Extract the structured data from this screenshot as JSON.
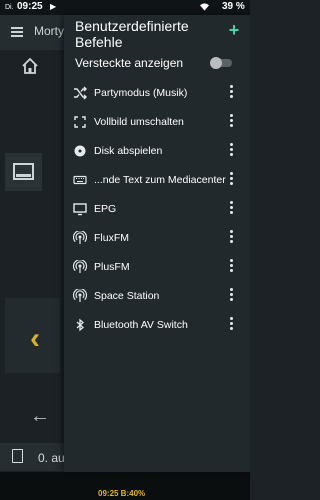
{
  "status_bar": {
    "day": "Di.",
    "time": "09:25",
    "battery": "39 %"
  },
  "background": {
    "app_title": "Morty",
    "bottom_bar_text": "0. au",
    "nav_clock": "09:25  B:40%"
  },
  "drawer": {
    "title": "Benutzerdefinierte Befehle",
    "add_label": "+",
    "show_hidden_label": "Versteckte anzeigen",
    "show_hidden_on": false,
    "items": [
      {
        "icon": "shuffle-icon",
        "label": "Partymodus (Musik)"
      },
      {
        "icon": "fullscreen-icon",
        "label": "Vollbild umschalten"
      },
      {
        "icon": "disc-icon",
        "label": "Disk abspielen"
      },
      {
        "icon": "keyboard-icon",
        "label": "...nde Text zum Mediacenter"
      },
      {
        "icon": "tv-icon",
        "label": "EPG"
      },
      {
        "icon": "radio-icon",
        "label": "FluxFM"
      },
      {
        "icon": "radio-icon",
        "label": "PlusFM"
      },
      {
        "icon": "radio-icon",
        "label": "Space Station"
      },
      {
        "icon": "bluetooth-icon",
        "label": "Bluetooth AV Switch"
      }
    ]
  }
}
